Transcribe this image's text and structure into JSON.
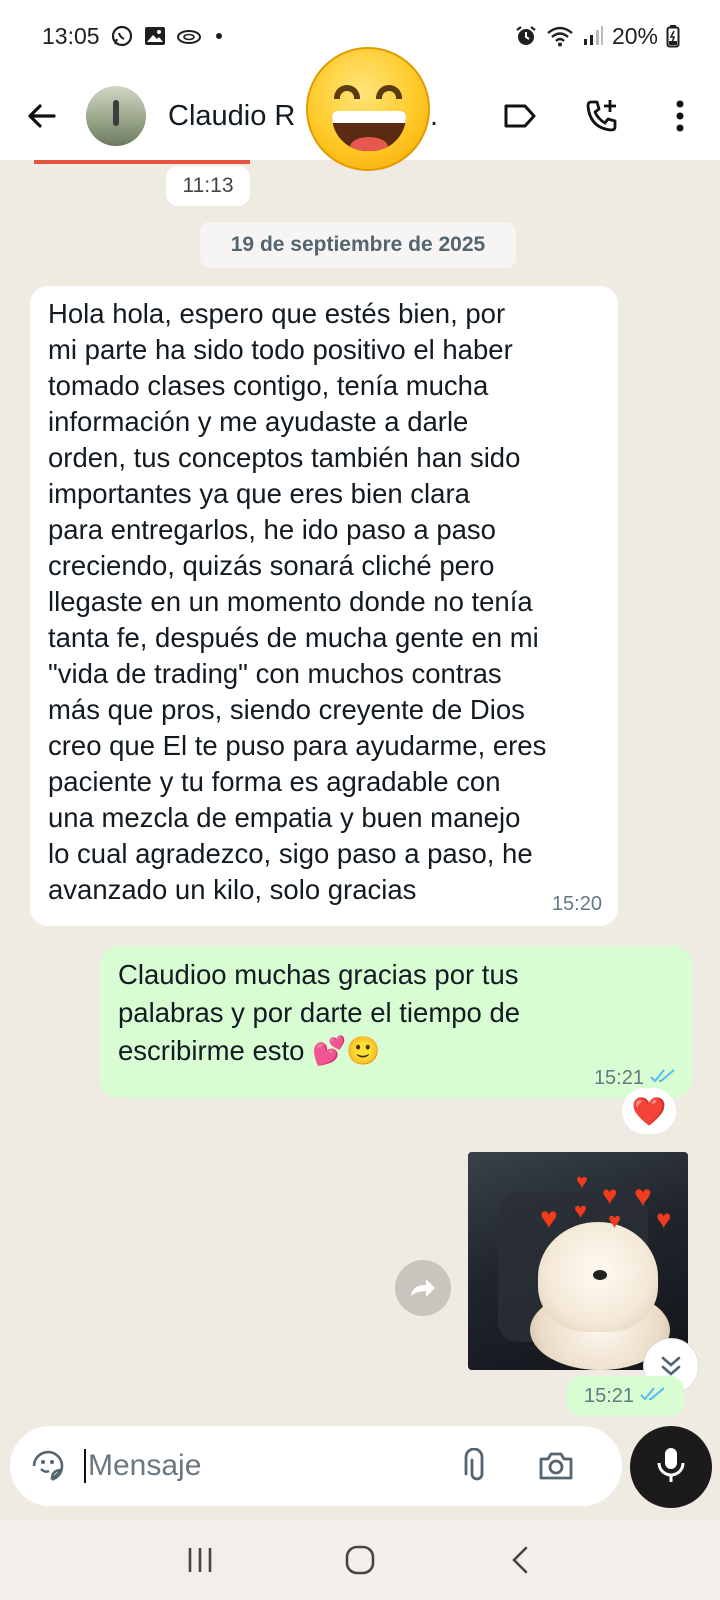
{
  "status_bar": {
    "time": "13:05",
    "battery": "20%",
    "left_icons": [
      "whatsapp-icon",
      "gallery-icon",
      "cloud-icon",
      "dot-icon"
    ],
    "right_icons": [
      "alarm-icon",
      "wifi-icon",
      "signal-icon",
      "battery-icon"
    ]
  },
  "header": {
    "contact_name_visible": "Claudio R",
    "contact_name_trailing": "...",
    "icons": [
      "back-arrow-icon",
      "label-icon",
      "add-call-icon",
      "more-vert-icon"
    ]
  },
  "chat": {
    "previous_time": "11:13",
    "date_divider": "19 de septiembre de 2025",
    "messages": [
      {
        "direction": "incoming",
        "lines": [
          "Hola hola, espero que estés bien, por",
          "mi parte ha sido todo positivo el haber",
          "tomado clases contigo, tenía mucha",
          "información y me ayudaste a darle",
          "orden, tus conceptos también han sido",
          "importantes ya que eres bien clara",
          "para entregarlos, he ido paso a paso",
          "creciendo, quizás sonará cliché pero",
          "llegaste en un momento donde no tenía",
          "tanta fe, después de mucha gente en mi",
          "\"vida de trading\" con muchos contras",
          "más que pros, siendo creyente de Dios",
          "creo que El te puso para ayudarme, eres",
          "paciente y tu forma es agradable con",
          "una mezcla de empatia y buen manejo",
          "lo cual agradezco, sigo paso a paso, he",
          "avanzado un kilo, solo gracias"
        ],
        "time": "15:20"
      },
      {
        "direction": "outgoing",
        "lines": [
          "Claudioo muchas gracias por tus",
          "palabras y por darte el tiempo de",
          "escribirme esto 💕🙂"
        ],
        "time": "15:21",
        "status": "read",
        "reaction": "❤️"
      },
      {
        "direction": "outgoing",
        "type": "image",
        "image_description_icon": "puppy-with-hearts-image",
        "time": "15:21",
        "status": "read"
      }
    ]
  },
  "composer": {
    "placeholder": "Mensaje",
    "value": "",
    "icons": [
      "sticker-icon",
      "attach-icon",
      "camera-icon",
      "mic-icon"
    ]
  },
  "nav": {
    "icons": [
      "recent-apps-icon",
      "home-icon",
      "back-icon"
    ]
  },
  "colors": {
    "chat_background": "#efeae2",
    "incoming_bubble": "#ffffff",
    "outgoing_bubble": "#d9fdd3",
    "read_ticks": "#53bdeb",
    "mic_button": "#1b1b1b"
  }
}
